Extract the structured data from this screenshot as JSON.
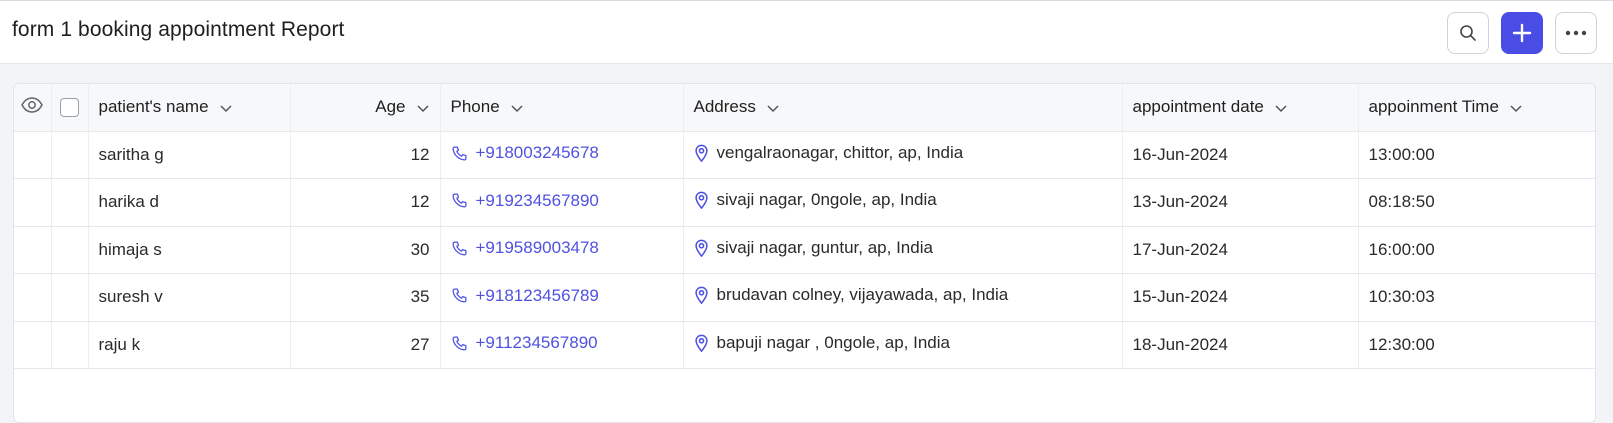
{
  "header": {
    "title": "form 1 booking appointment Report",
    "search_icon": "search-icon",
    "add_icon": "plus-icon",
    "more_icon": "more-horizontal-icon",
    "accent_color": "#4a4ce6"
  },
  "table": {
    "columns": [
      {
        "key": "name",
        "label": "patient's name"
      },
      {
        "key": "age",
        "label": "Age"
      },
      {
        "key": "phone",
        "label": "Phone"
      },
      {
        "key": "address",
        "label": "Address"
      },
      {
        "key": "date",
        "label": "appointment date"
      },
      {
        "key": "time",
        "label": "appoinment Time"
      }
    ],
    "rows": [
      {
        "name": "saritha g",
        "age": "12",
        "phone": "+918003245678",
        "address": "vengalraonagar, chittor, ap, India",
        "date": "16-Jun-2024",
        "time": "13:00:00"
      },
      {
        "name": "harika d",
        "age": "12",
        "phone": "+919234567890",
        "address": "sivaji nagar, 0ngole, ap, India",
        "date": "13-Jun-2024",
        "time": "08:18:50"
      },
      {
        "name": "himaja s",
        "age": "30",
        "phone": "+919589003478",
        "address": "sivaji nagar, guntur, ap, India",
        "date": "17-Jun-2024",
        "time": "16:00:00"
      },
      {
        "name": "suresh v",
        "age": "35",
        "phone": "+918123456789",
        "address": "brudavan colney, vijayawada, ap, India",
        "date": "15-Jun-2024",
        "time": "10:30:03"
      },
      {
        "name": "raju k",
        "age": "27",
        "phone": "+911234567890",
        "address": "bapuji nagar , 0ngole, ap, India",
        "date": "18-Jun-2024",
        "time": "12:30:00"
      }
    ],
    "link_color": "#4f52e0"
  }
}
